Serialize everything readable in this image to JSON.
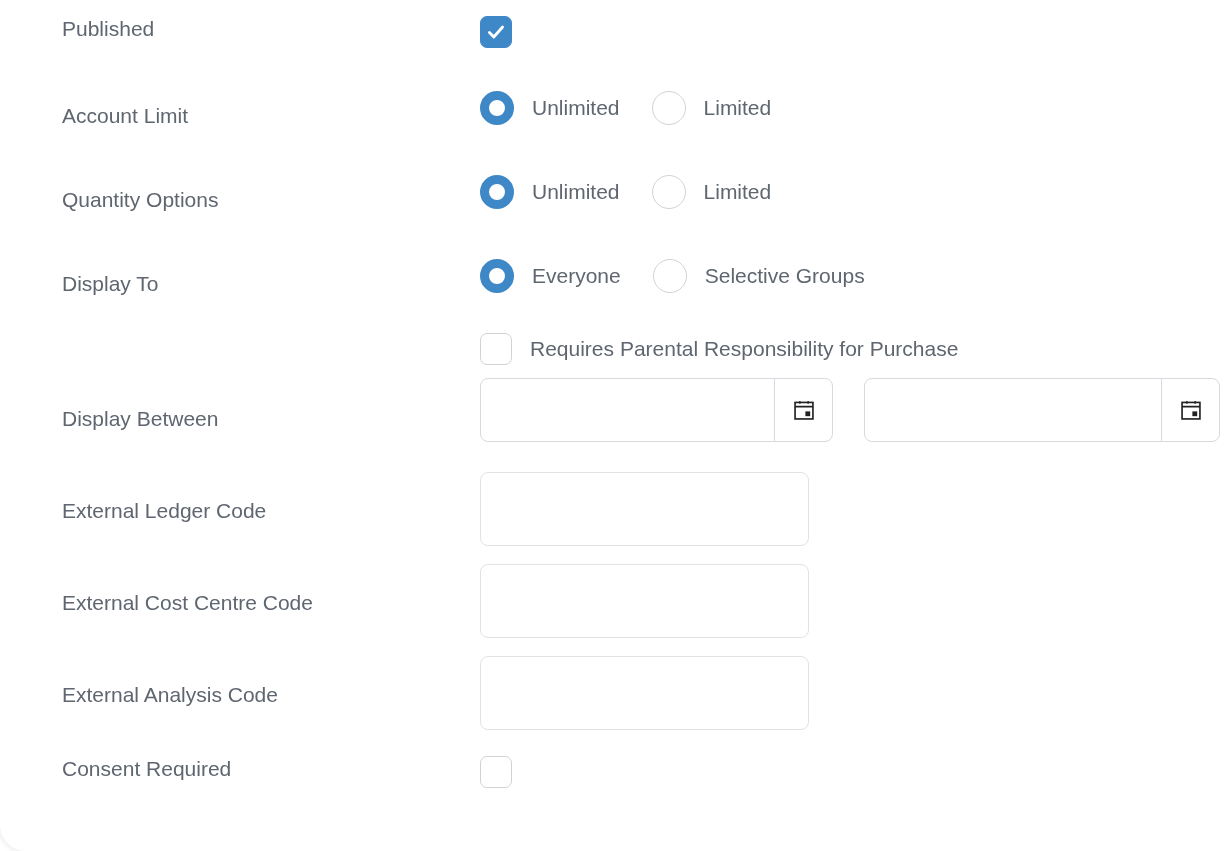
{
  "fields": [
    {
      "kind": "checkbox",
      "label": "Published",
      "checked": true
    },
    {
      "kind": "radio",
      "label": "Account Limit",
      "options": [
        {
          "label": "Unlimited",
          "selected": true
        },
        {
          "label": "Limited",
          "selected": false
        }
      ]
    },
    {
      "kind": "radio",
      "label": "Quantity Options",
      "options": [
        {
          "label": "Unlimited",
          "selected": true
        },
        {
          "label": "Limited",
          "selected": false
        }
      ]
    },
    {
      "kind": "radio",
      "label": "Display To",
      "options": [
        {
          "label": "Everyone",
          "selected": true
        },
        {
          "label": "Selective Groups",
          "selected": false
        }
      ]
    },
    {
      "kind": "inline-checkbox",
      "text": "Requires Parental Responsibility for Purchase",
      "checked": false
    },
    {
      "kind": "daterange",
      "label": "Display Between"
    },
    {
      "kind": "text",
      "label": "External Ledger Code"
    },
    {
      "kind": "text",
      "label": "External Cost Centre Code"
    },
    {
      "kind": "text",
      "label": "External Analysis Code"
    },
    {
      "kind": "checkbox",
      "label": "Consent Required",
      "checked": false
    }
  ]
}
